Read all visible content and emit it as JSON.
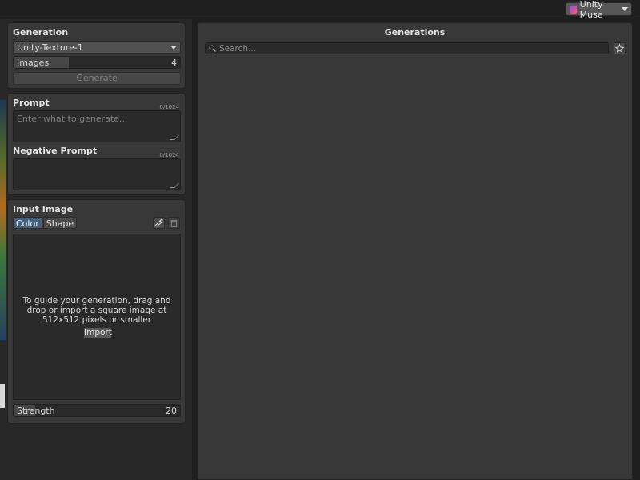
{
  "topbar": {
    "account_label": "Unity Muse"
  },
  "generation": {
    "title": "Generation",
    "model": "Unity-Texture-1",
    "images_label": "Images",
    "images_value": "4",
    "images_fraction": 0.33,
    "generate_label": "Generate"
  },
  "prompt": {
    "title": "Prompt",
    "counter": "0/1024",
    "placeholder": "Enter what to generate...",
    "negative_title": "Negative Prompt",
    "negative_counter": "0/1024"
  },
  "input_image": {
    "title": "Input Image",
    "tabs": [
      "Color",
      "Shape"
    ],
    "active_tab": "Color",
    "drop_text": "To guide your generation, drag and drop or import a square image at 512x512 pixels or smaller",
    "import_label": "Import",
    "strength_label": "Strength",
    "strength_value": "20",
    "strength_fraction": 0.13
  },
  "generations": {
    "title": "Generations",
    "search_placeholder": "Search..."
  },
  "colors": {
    "active_tab": "#46607c",
    "panel": "#383838",
    "field": "#2a2a2a"
  }
}
